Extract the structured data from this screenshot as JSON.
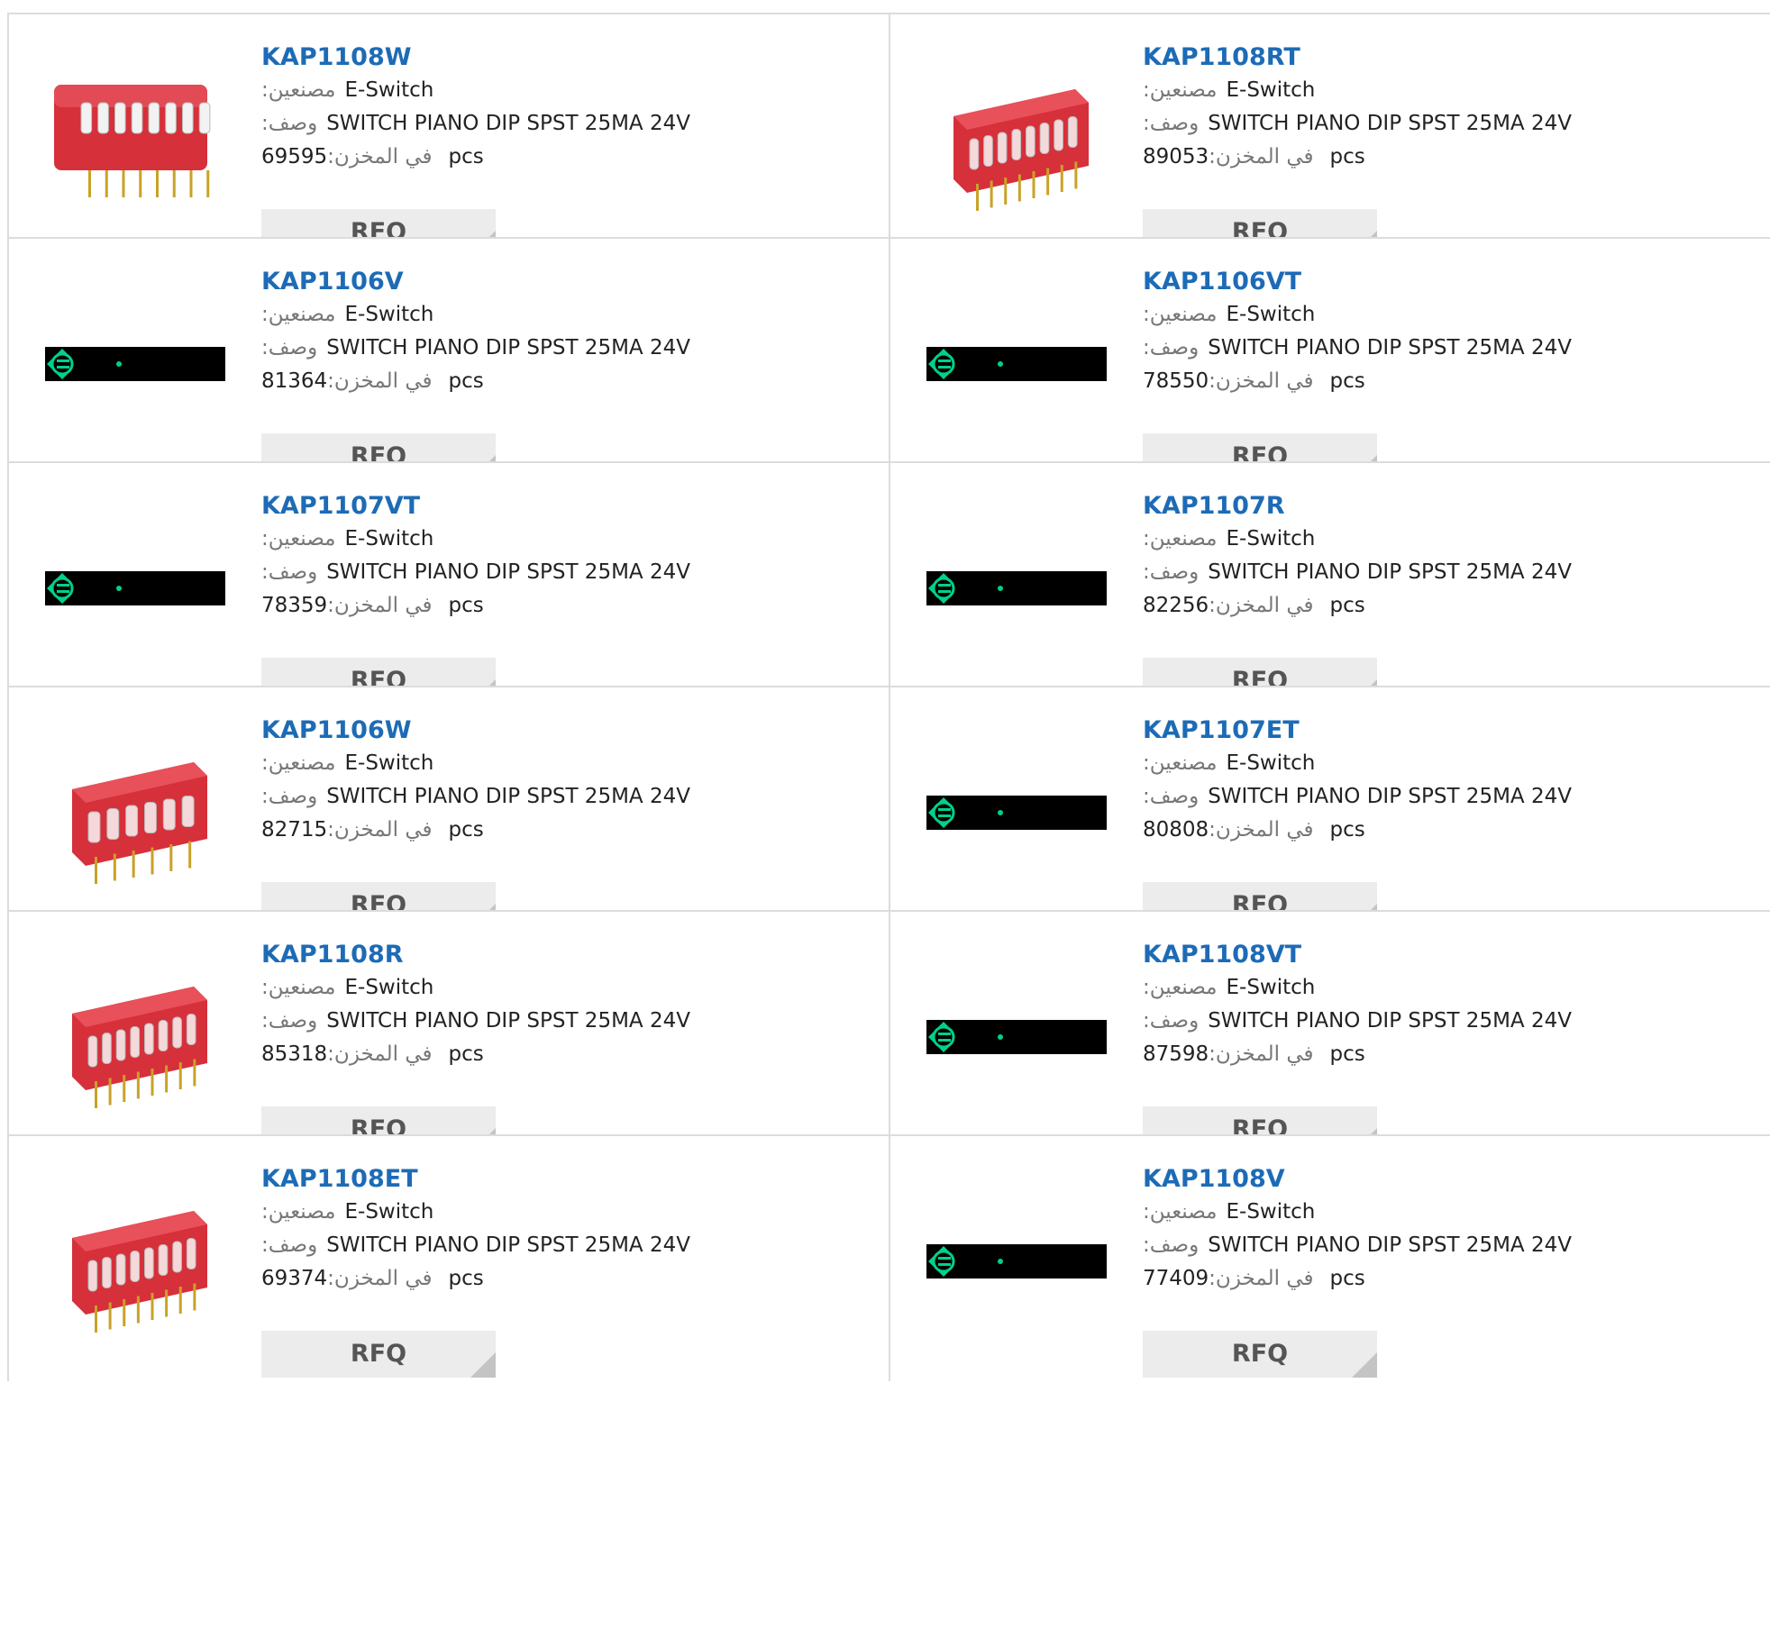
{
  "labels": {
    "manufacturer": ":مصنعين",
    "description": ":وصف",
    "stock": ":في المخزن",
    "unit": "pcs",
    "rfq": "RFQ"
  },
  "colors": {
    "part_link": "#1d6bb6",
    "border": "#dcdcdc",
    "button_bg": "#ececec",
    "placeholder_bg": "#000000",
    "placeholder_icon": "#00d18a",
    "switch_body": "#d6303a"
  },
  "products": [
    {
      "part": "KAP1108W",
      "manufacturer": "E-Switch",
      "description": "SWITCH PIANO DIP SPST 25MA 24V",
      "stock": "69595",
      "image": "dip-switch-8-white-keys"
    },
    {
      "part": "KAP1108RT",
      "manufacturer": "E-Switch",
      "description": "SWITCH PIANO DIP SPST 25MA 24V",
      "stock": "89053",
      "image": "dip-switch-8-red-angled"
    },
    {
      "part": "KAP1106V",
      "manufacturer": "E-Switch",
      "description": "SWITCH PIANO DIP SPST 25MA 24V",
      "stock": "81364",
      "image": "placeholder"
    },
    {
      "part": "KAP1106VT",
      "manufacturer": "E-Switch",
      "description": "SWITCH PIANO DIP SPST 25MA 24V",
      "stock": "78550",
      "image": "placeholder"
    },
    {
      "part": "KAP1107VT",
      "manufacturer": "E-Switch",
      "description": "SWITCH PIANO DIP SPST 25MA 24V",
      "stock": "78359",
      "image": "placeholder"
    },
    {
      "part": "KAP1107R",
      "manufacturer": "E-Switch",
      "description": "SWITCH PIANO DIP SPST 25MA 24V",
      "stock": "82256",
      "image": "placeholder"
    },
    {
      "part": "KAP1106W",
      "manufacturer": "E-Switch",
      "description": "SWITCH PIANO DIP SPST 25MA 24V",
      "stock": "82715",
      "image": "dip-switch-6-red"
    },
    {
      "part": "KAP1107ET",
      "manufacturer": "E-Switch",
      "description": "SWITCH PIANO DIP SPST 25MA 24V",
      "stock": "80808",
      "image": "placeholder"
    },
    {
      "part": "KAP1108R",
      "manufacturer": "E-Switch",
      "description": "SWITCH PIANO DIP SPST 25MA 24V",
      "stock": "85318",
      "image": "dip-switch-8-red-angled"
    },
    {
      "part": "KAP1108VT",
      "manufacturer": "E-Switch",
      "description": "SWITCH PIANO DIP SPST 25MA 24V",
      "stock": "87598",
      "image": "placeholder"
    },
    {
      "part": "KAP1108ET",
      "manufacturer": "E-Switch",
      "description": "SWITCH PIANO DIP SPST 25MA 24V",
      "stock": "69374",
      "image": "dip-switch-8-red-angled"
    },
    {
      "part": "KAP1108V",
      "manufacturer": "E-Switch",
      "description": "SWITCH PIANO DIP SPST 25MA 24V",
      "stock": "77409",
      "image": "placeholder"
    }
  ]
}
